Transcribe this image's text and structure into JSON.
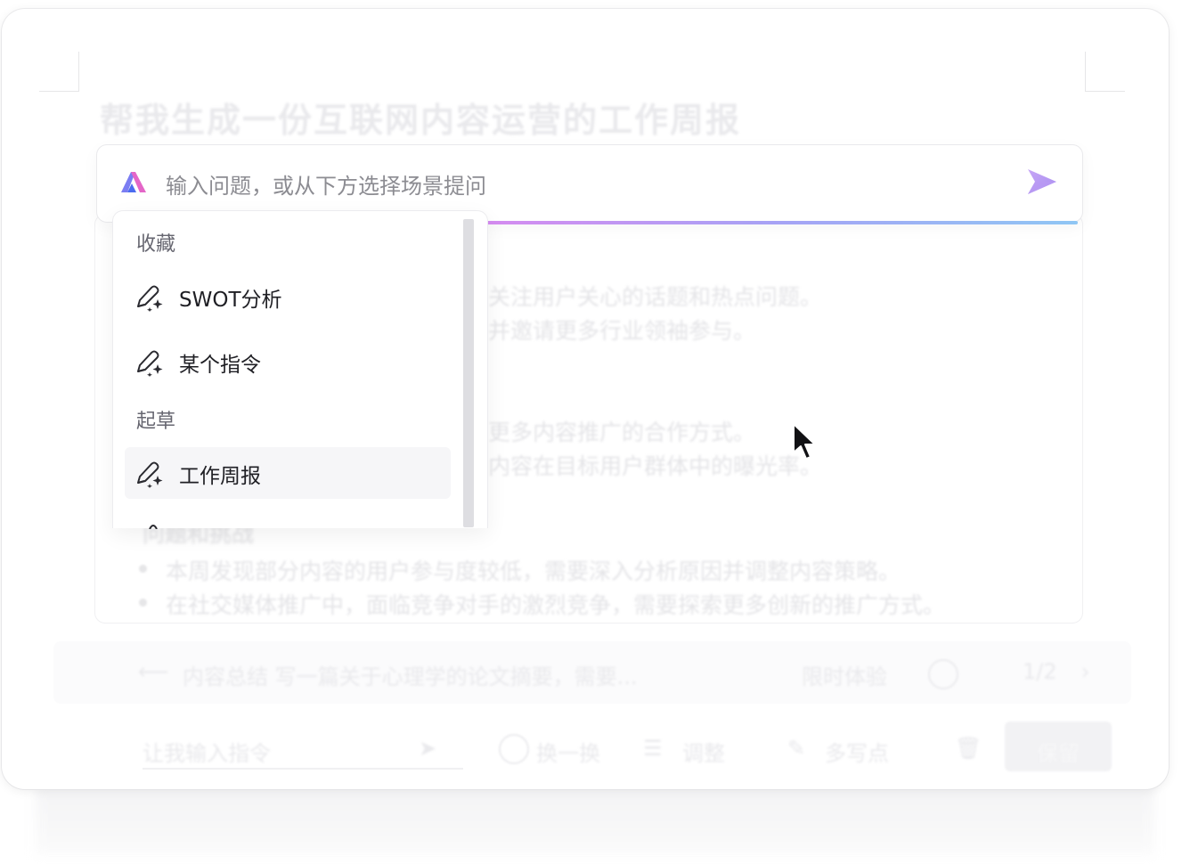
{
  "document": {
    "title": "帮我生成一份互联网内容运营的工作周报",
    "lines": [
      "关注用户关心的话题和热点问题。",
      "并邀请更多行业领袖参与。",
      "更多内容推广的合作方式。",
      "内容在目标用户群体中的曝光率。"
    ],
    "bullets": [
      "本周发现部分内容的用户参与度较低，需要深入分析原因并调整内容策略。",
      "在社交媒体推广中，面临竞争对手的激烈竞争，需要探索更多创新的推广方式。"
    ],
    "faded_heading": "问题和挑战"
  },
  "bottom": {
    "history_text": "内容总结 写一篇关于心理学的论文摘要，需要...",
    "trial_label": "限时体验",
    "pager": "1/2",
    "instruction_placeholder": "让我输入指令",
    "actions": [
      "换一换",
      "调整",
      "多写点"
    ],
    "keep_label": "保留"
  },
  "ai_input": {
    "placeholder": "输入问题，或从下方选择场景提问",
    "logo_colors": [
      "#7b7df2",
      "#e466c8",
      "#4b6cf0"
    ],
    "accent_colors": [
      "#d58bf0",
      "#a5a3f5",
      "#8fc6f4"
    ]
  },
  "dropdown": {
    "sections": [
      {
        "label": "收藏",
        "items": [
          {
            "label": "SWOT分析",
            "icon": "pen-sparkle-icon"
          },
          {
            "label": "某个指令",
            "icon": "pen-sparkle-icon"
          }
        ]
      },
      {
        "label": "起草",
        "items": [
          {
            "label": "工作周报",
            "icon": "pen-sparkle-icon"
          }
        ]
      }
    ]
  }
}
